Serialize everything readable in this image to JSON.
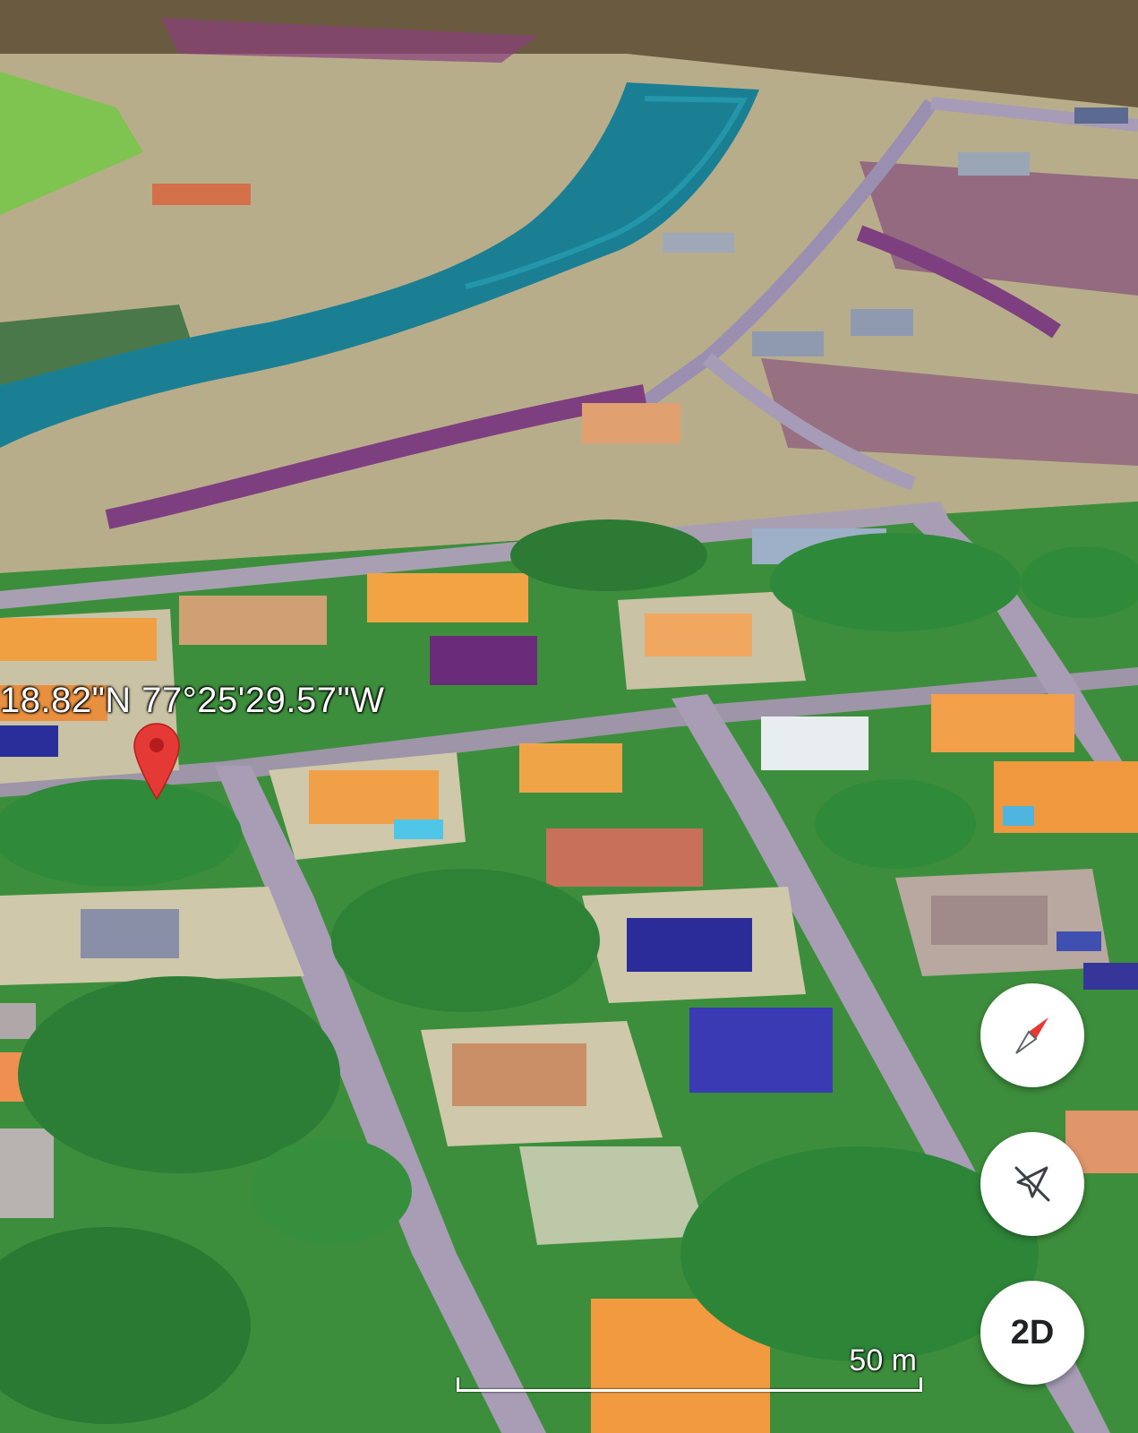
{
  "map": {
    "view": "satellite-3d",
    "coordinate_label": "18.82\"N 77°25'29.57\"W",
    "marker_icon": "location-pin-icon",
    "marker_color": "#e53935"
  },
  "controls": {
    "compass_icon": "compass-icon",
    "compass_color": "#e53935",
    "tilt_icon": "tilt-off-icon",
    "mode_label": "2D"
  },
  "scale": {
    "label": "50 m"
  }
}
